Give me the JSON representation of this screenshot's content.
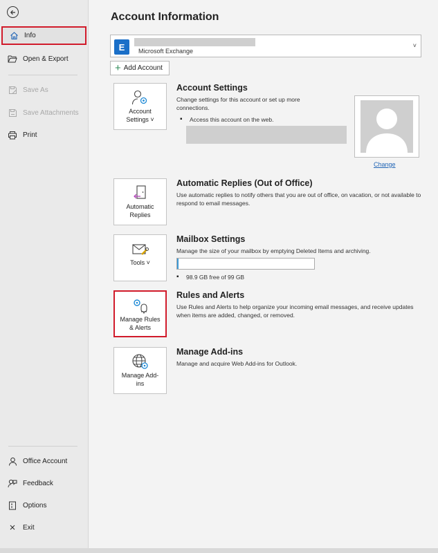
{
  "sidebar": {
    "back_icon": "arrow-left-circle-icon",
    "top_items": [
      {
        "label": "Info",
        "icon": "home-icon",
        "state": "active"
      },
      {
        "label": "Open & Export",
        "icon": "folder-open-icon",
        "state": "normal"
      },
      {
        "label": "Save As",
        "icon": "save-as-icon",
        "state": "disabled"
      },
      {
        "label": "Save Attachments",
        "icon": "save-attachments-icon",
        "state": "disabled"
      },
      {
        "label": "Print",
        "icon": "printer-icon",
        "state": "normal"
      }
    ],
    "bottom_items": [
      {
        "label": "Office Account",
        "icon": "person-icon"
      },
      {
        "label": "Feedback",
        "icon": "feedback-icon"
      },
      {
        "label": "Options",
        "icon": "options-icon"
      },
      {
        "label": "Exit",
        "icon": "close-icon"
      }
    ]
  },
  "main": {
    "title": "Account Information",
    "account_selector": {
      "type_label": "Microsoft Exchange",
      "icon": "exchange-icon"
    },
    "add_account_label": "Add Account",
    "account_settings": {
      "tile_label": "Account Settings ˅",
      "title": "Account Settings",
      "description": "Change settings for this account or set up more connections.",
      "bullet": "Access this account on the web.",
      "change_link": "Change"
    },
    "automatic_replies": {
      "tile_label": "Automatic Replies",
      "title": "Automatic Replies (Out of Office)",
      "description": "Use automatic replies to notify others that you are out of office, on vacation, or not available to respond to email messages."
    },
    "mailbox_settings": {
      "tile_label": "Tools ˅",
      "title": "Mailbox Settings",
      "description": "Manage the size of your mailbox by emptying Deleted Items and archiving.",
      "usage_fraction": 0.01,
      "free_text": "98.9 GB free of 99 GB"
    },
    "rules_alerts": {
      "tile_label": "Manage Rules & Alerts",
      "title": "Rules and Alerts",
      "description": "Use Rules and Alerts to help organize your incoming email messages, and receive updates when items are added, changed, or removed."
    },
    "add_ins": {
      "tile_label": "Manage Add-ins",
      "title": "Manage Add-ins",
      "description": "Manage and acquire Web Add-ins for Outlook."
    }
  },
  "colors": {
    "highlight": "#d11a2a",
    "link": "#1e63b5",
    "progress": "#3c9ad6",
    "exchange": "#1a6fc8"
  }
}
